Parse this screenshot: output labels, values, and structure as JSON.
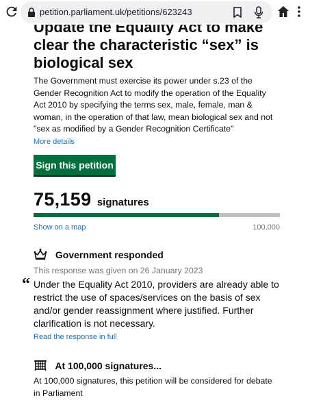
{
  "browser": {
    "url": "petition.parliament.uk/petitions/623243",
    "icons": [
      "reload-icon",
      "lock-icon",
      "bookmark-icon",
      "mic-icon",
      "home-icon",
      "more-vert-icon"
    ]
  },
  "petition": {
    "title": "Update the Equality Act to make clear the characteristic “sex” is biological sex",
    "description": "The Government must exercise its power under s.23 of the Gender Recognition Act to modify the operation of the Equality Act 2010 by specifying the terms sex, male, female, man & woman, in the operation of that law, mean biological sex and not \"sex as modified by a Gender Recognition Certificate\"",
    "more_details": "More details",
    "sign_button": "Sign this petition"
  },
  "signatures": {
    "count": "75,159",
    "label": "signatures",
    "progress_value": 75159,
    "target_value": 100000,
    "target_label": "100,000",
    "map_link": "Show on a map"
  },
  "government": {
    "heading": "Government responded",
    "date_text": "This response was given on 26 January 2023",
    "quote_mark": "“",
    "quote": "Under the Equality Act 2010, providers are already able to restrict the use of spaces/services on the basis of sex and/or gender reassignment where justified. Further clarification is not necessary.",
    "read_link": "Read the response in full"
  },
  "debate": {
    "heading": "At 100,000 signatures...",
    "text": "At 100,000 signatures, this petition will be considered for debate in Parliament"
  },
  "colors": {
    "accent_green": "#00703c",
    "link_blue": "#1d70b8",
    "track_grey": "#bfc1c3"
  }
}
